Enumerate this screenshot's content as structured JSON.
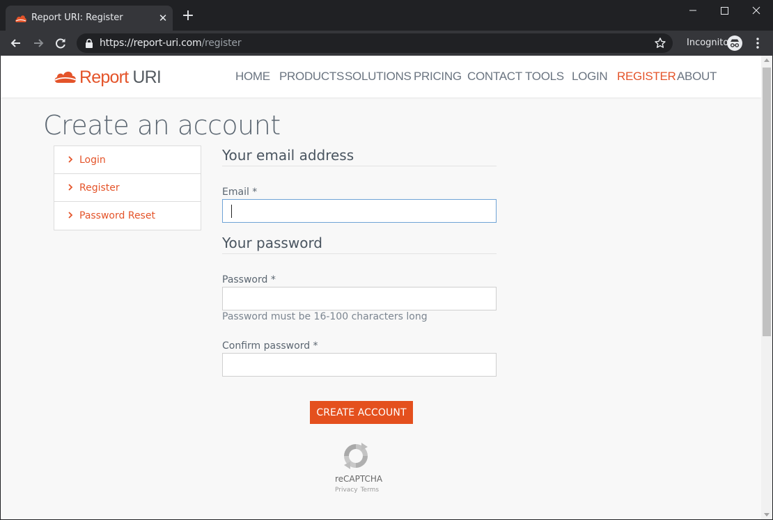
{
  "browser": {
    "tab_title": "Report URI: Register",
    "tab_close": "✕",
    "new_tab": "+",
    "url_host": "https://report-uri.com",
    "url_path": "/register",
    "incognito_label": "Incognito"
  },
  "site": {
    "logo_brand": "Report ",
    "logo_uri": "URI",
    "brand_color": "#e4542a",
    "nav": [
      "HOME",
      "PRODUCTS",
      "SOLUTIONS",
      "PRICING",
      "CONTACT",
      "TOOLS",
      "LOGIN",
      "REGISTER",
      "ABOUT"
    ],
    "active_nav": "REGISTER"
  },
  "page": {
    "title": "Create an account",
    "side_menu": [
      "Login",
      "Register",
      "Password Reset"
    ],
    "email_section_title": "Your email address",
    "email_label": "Email *",
    "email_value": "",
    "password_section_title": "Your password",
    "password_label": "Password *",
    "password_help": "Password must be 16-100 characters long",
    "confirm_label": "Confirm password *",
    "submit_label": "CREATE ACCOUNT",
    "recaptcha_label": "reCAPTCHA",
    "recaptcha_privacy": "Privacy",
    "recaptcha_terms": "Terms"
  }
}
